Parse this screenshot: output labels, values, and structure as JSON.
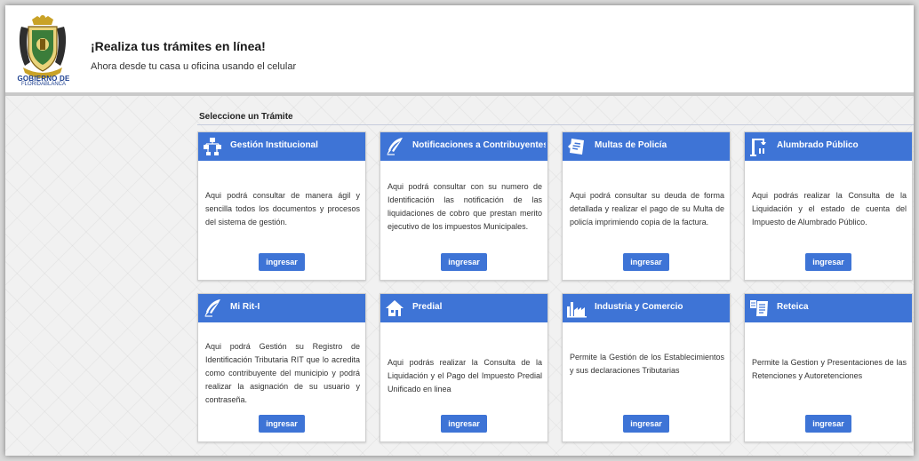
{
  "header": {
    "logo_line1": "GOBIERNO DE",
    "logo_line2": "FLORIDABLANCA",
    "title": "¡Realiza tus trámites en línea!",
    "subtitle": "Ahora desde tu casa u oficina usando el celular"
  },
  "section": {
    "title": "Seleccione un Trámite"
  },
  "colors": {
    "accent": "#3e74d6",
    "logo_text": "#1c3f8f"
  },
  "cards": [
    {
      "icon": "network-icon",
      "title": "Gestión Institucional",
      "description": "Aqui podrá consultar de manera ágil y sencilla todos los documentos y procesos del sistema de gestión.",
      "button": "ingresar"
    },
    {
      "icon": "quill-icon",
      "title": "Notificaciones a Contribuyentes",
      "description": "Aqui podrá consultar con su numero de Identificación las notificación de las liquidaciones de cobro que prestan merito ejecutivo de los impuestos Municipales.",
      "button": "ingresar"
    },
    {
      "icon": "ticket-icon",
      "title": "Multas de Policía",
      "description": "Aqui podrá consultar su deuda de forma detallada y realizar el pago de su Multa de policía imprimiendo copia de la factura.",
      "button": "ingresar"
    },
    {
      "icon": "streetlight-icon",
      "title": "Alumbrado Público",
      "description": "Aqui podrás realizar la Consulta de la Liquidación y el estado de cuenta del Impuesto de Alumbrado Público.",
      "button": "ingresar"
    },
    {
      "icon": "quill-icon",
      "title": "Mi Rit-I",
      "description": "Aqui podrá Gestión su Registro de Identificación Tributaria RIT que lo acredita como contribuyente del municipio y podrá realizar la asignación de su usuario y contraseña.",
      "button": "ingresar"
    },
    {
      "icon": "house-icon",
      "title": "Predial",
      "description": "Aqui podrás realizar la Consulta de la Liquidación y el Pago del Impuesto Predial Unificado en linea",
      "button": "ingresar"
    },
    {
      "icon": "factory-icon",
      "title": "Industria y Comercio",
      "description": "Permite la Gestión de los Establecimientos y sus declaraciones Tributarias",
      "button": "ingresar"
    },
    {
      "icon": "receipt-icon",
      "title": "Reteica",
      "description": "Permite la Gestion y Presentaciones de las Retenciones y Autoretenciones",
      "button": "ingresar"
    }
  ]
}
